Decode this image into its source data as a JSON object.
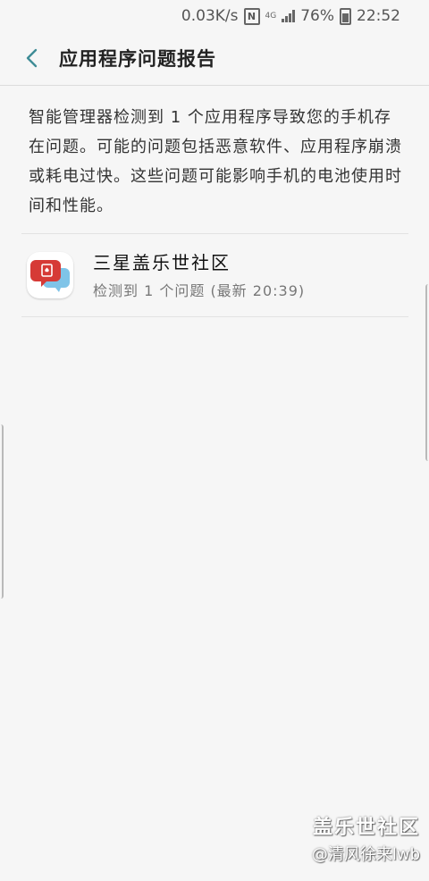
{
  "status_bar": {
    "network_speed": "0.03K/s",
    "nfc": "N",
    "network_type": "4G",
    "battery_percent": "76%",
    "time": "22:52"
  },
  "header": {
    "title": "应用程序问题报告"
  },
  "description": "智能管理器检测到 1 个应用程序导致您的手机存在问题。可能的问题包括恶意软件、应用程序崩溃或耗电过快。这些问题可能影响手机的电池使用时间和性能。",
  "apps": [
    {
      "name": "三星盖乐世社区",
      "subtitle": "检测到 1 个问题 (最新 20:39)"
    }
  ],
  "watermark": {
    "title": "盖乐世社区",
    "author": "@清风徐来lwb"
  },
  "colors": {
    "accent": "#3f8c96",
    "background": "#f6f6f6",
    "app_icon_red": "#d63a36",
    "app_icon_blue": "#7fc4e8"
  }
}
